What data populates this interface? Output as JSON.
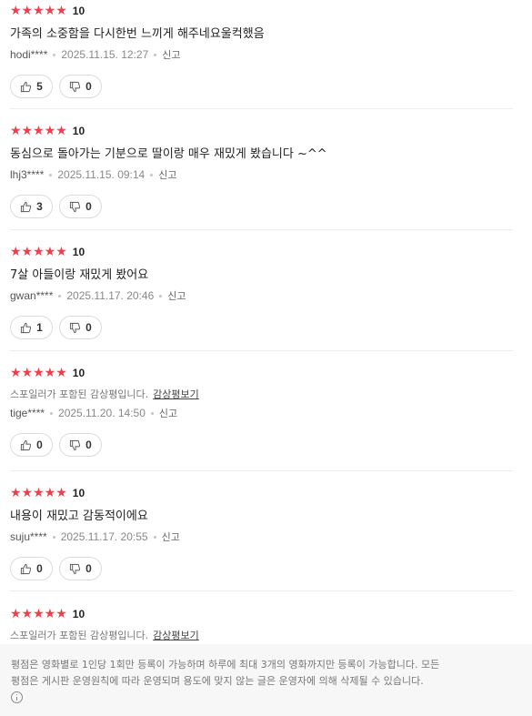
{
  "reviews": [
    {
      "stars": "★★★★★",
      "score": "10",
      "content": "가족의 소중함을 다시한번 느끼게 해주네요울컥했음",
      "writer": "hodi****",
      "date": "2025.11.15. 12:27",
      "report": "신고",
      "likes": "5",
      "dislikes": "0"
    },
    {
      "stars": "★★★★★",
      "score": "10",
      "content": "동심으로 돌아가는 기분으로 딸이랑 매우 재밌게 봤습니다 ~^^",
      "writer": "lhj3****",
      "date": "2025.11.15. 09:14",
      "report": "신고",
      "likes": "3",
      "dislikes": "0"
    },
    {
      "stars": "★★★★★",
      "score": "10",
      "content": "7살 아들이랑 재밌게 봤어요",
      "writer": "gwan****",
      "date": "2025.11.17. 20:46",
      "report": "신고",
      "likes": "1",
      "dislikes": "0"
    },
    {
      "stars": "★★★★★",
      "score": "10",
      "spoiler": "스포일러가 포함된 감상평입니다.",
      "spoiler_link": "감상평보기",
      "writer": "tige****",
      "date": "2025.11.20. 14:50",
      "report": "신고",
      "likes": "0",
      "dislikes": "0"
    },
    {
      "stars": "★★★★★",
      "score": "10",
      "content": "내용이 재밌고 감동적이에요",
      "writer": "suju****",
      "date": "2025.11.17. 20:55",
      "report": "신고",
      "likes": "0",
      "dislikes": "0"
    },
    {
      "stars": "★★★★★",
      "score": "10",
      "spoiler": "스포일러가 포함된 감상평입니다.",
      "spoiler_link": "감상평보기"
    }
  ],
  "notice": {
    "line1": "평점은 영화별로 1인당 1회만 등록이 가능하며 하루에 최대 3개의 영화까지만 등록이 가능합니다. 모든",
    "line2": "평점은 게시판 운영원칙에 따라 운영되며 용도에 맞지 않는 글은 운영자에 의해 삭제될 수 있습니다."
  },
  "icons": {
    "like": "thumbs-up-icon",
    "dislike": "thumbs-down-icon",
    "info": "info-circle-icon"
  },
  "colors": {
    "star": "#f03e4a",
    "notice_bg": "#f7f7f7"
  }
}
